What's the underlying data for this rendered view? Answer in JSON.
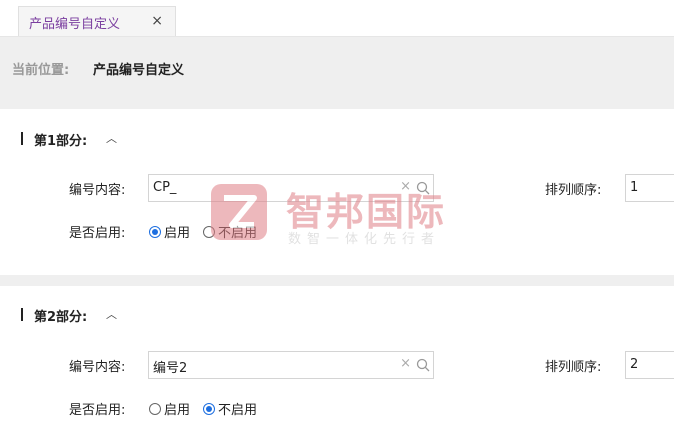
{
  "tabs": [
    {
      "label": "产品编号自定义",
      "close_icon": "×"
    }
  ],
  "breadcrumb": {
    "prefix": "当前位置:",
    "current": "产品编号自定义"
  },
  "sections": [
    {
      "title": "第1部分:",
      "toggle": "︿",
      "content_label": "编号内容:",
      "content_value": "CP_",
      "order_label": "排列顺序:",
      "order_value": "1",
      "enable_label": "是否启用:",
      "radio_enable": "启用",
      "radio_disable": "不启用",
      "enabled": true
    },
    {
      "title": "第2部分:",
      "toggle": "︿",
      "content_label": "编号内容:",
      "content_value": "编号2",
      "order_label": "排列顺序:",
      "order_value": "2",
      "enable_label": "是否启用:",
      "radio_enable": "启用",
      "radio_disable": "不启用",
      "enabled": false
    }
  ],
  "watermark": {
    "brand": "智邦国际",
    "slogan": "数智一体化先行者"
  },
  "icons": {
    "clear": "×",
    "search": "search-icon"
  },
  "colors": {
    "accent": "#1e6fe0",
    "tab_text": "#7b3fa0",
    "watermark": "#e07f86"
  }
}
